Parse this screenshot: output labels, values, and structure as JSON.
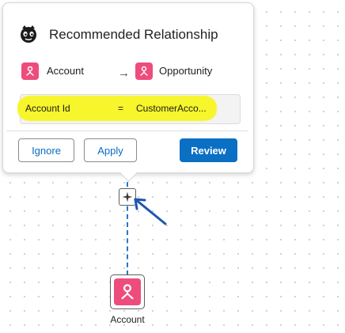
{
  "popup": {
    "title": "Recommended Relationship",
    "title_icon": "copilot-icon",
    "source": {
      "label": "Account",
      "icon": "entity-icon"
    },
    "arrow": "→",
    "target": {
      "label": "Opportunity",
      "icon": "entity-icon"
    },
    "mapping": {
      "left_field": "Account Id",
      "operator": "=",
      "right_field": "CustomerAcco..."
    },
    "buttons": {
      "ignore": "Ignore",
      "apply": "Apply",
      "review": "Review"
    }
  },
  "canvas": {
    "ai_button_icon": "sparkle-icon",
    "node": {
      "label": "Account",
      "icon": "entity-icon"
    }
  },
  "colors": {
    "entity": "#EE4C7C",
    "primary": "#0B6FC4",
    "link": "#0B6BC7",
    "connector": "#1F78D1",
    "highlight": "#F7F52B"
  }
}
